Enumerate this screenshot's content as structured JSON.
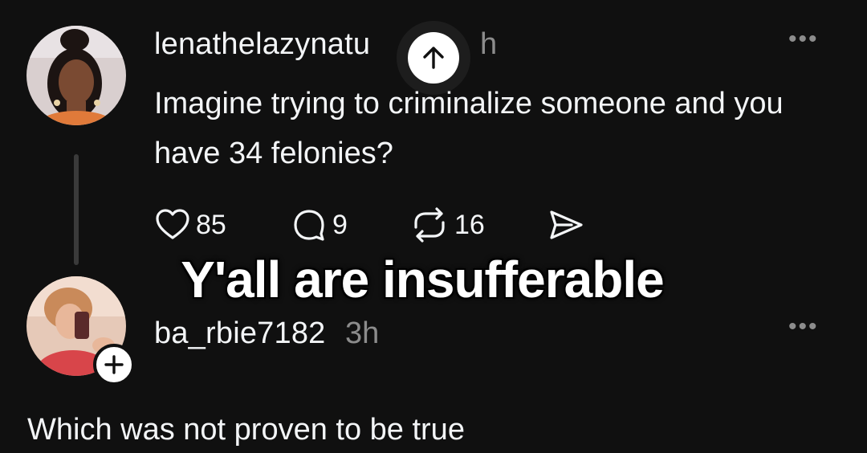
{
  "post": {
    "username": "lenathelazynatu",
    "time": "h",
    "text": "Imagine trying to criminalize someone and you have 34 felonies?",
    "likes": "85",
    "replies": "9",
    "reposts": "16",
    "more": "•••"
  },
  "overlay": {
    "caption": "Y'all are insufferable"
  },
  "reply": {
    "username": "ba_rbie7182",
    "time": "3h",
    "text": "Which was not proven to be true",
    "more": "•••"
  },
  "icons": {
    "like": "heart-icon",
    "reply": "comment-icon",
    "repost": "repost-icon",
    "share": "send-icon",
    "scroll_up": "arrow-up-icon",
    "follow": "plus-icon"
  },
  "colors": {
    "background": "#101010",
    "text": "#f3f5f7",
    "muted": "#8c8c8c",
    "thread_line": "#3a3a3a"
  }
}
